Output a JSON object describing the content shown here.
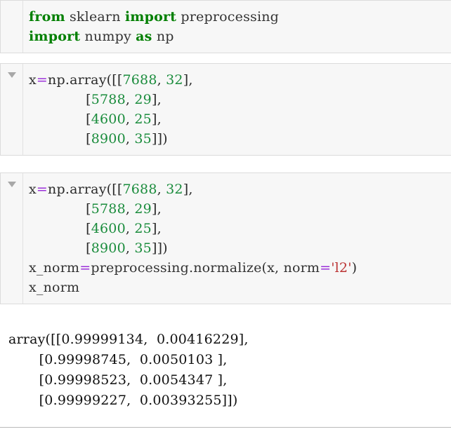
{
  "document": {
    "type": "jupyter-notebook",
    "colors": {
      "keyword": "#007f00",
      "number": "#1a8c3c",
      "operator": "#9b30d9",
      "string": "#bb3333",
      "text": "#2b2b2b",
      "cell_background": "#f7f7f7",
      "cell_border": "#dcdcdc",
      "output_text": "#101010",
      "triangle": "#a8a8a8"
    }
  },
  "cells": [
    {
      "id": "cell-imports",
      "has_collapse_triangle": false,
      "lines": [
        {
          "segments": [
            {
              "text": "from",
              "type": "kw"
            },
            {
              "text": " sklearn ",
              "type": "plain"
            },
            {
              "text": "import",
              "type": "kw"
            },
            {
              "text": " preprocessing",
              "type": "plain"
            }
          ]
        },
        {
          "segments": [
            {
              "text": "import",
              "type": "kw"
            },
            {
              "text": " numpy ",
              "type": "plain"
            },
            {
              "text": "as",
              "type": "kw"
            },
            {
              "text": " np",
              "type": "plain"
            }
          ]
        }
      ]
    },
    {
      "id": "cell-array",
      "has_collapse_triangle": true,
      "lines": [
        {
          "segments": [
            {
              "text": "x",
              "type": "plain"
            },
            {
              "text": "=",
              "type": "op"
            },
            {
              "text": "np.array([[",
              "type": "punc"
            },
            {
              "text": "7688",
              "type": "num"
            },
            {
              "text": ", ",
              "type": "punc"
            },
            {
              "text": "32",
              "type": "num"
            },
            {
              "text": "],",
              "type": "punc"
            }
          ]
        },
        {
          "segments": [
            {
              "text": "             [",
              "type": "punc"
            },
            {
              "text": "5788",
              "type": "num"
            },
            {
              "text": ", ",
              "type": "punc"
            },
            {
              "text": "29",
              "type": "num"
            },
            {
              "text": "],",
              "type": "punc"
            }
          ]
        },
        {
          "segments": [
            {
              "text": "             [",
              "type": "punc"
            },
            {
              "text": "4600",
              "type": "num"
            },
            {
              "text": ", ",
              "type": "punc"
            },
            {
              "text": "25",
              "type": "num"
            },
            {
              "text": "],",
              "type": "punc"
            }
          ]
        },
        {
          "segments": [
            {
              "text": "             [",
              "type": "punc"
            },
            {
              "text": "8900",
              "type": "num"
            },
            {
              "text": ", ",
              "type": "punc"
            },
            {
              "text": "35",
              "type": "num"
            },
            {
              "text": "]])",
              "type": "punc"
            }
          ]
        }
      ]
    },
    {
      "id": "cell-normalize",
      "has_collapse_triangle": true,
      "lines": [
        {
          "segments": [
            {
              "text": "x",
              "type": "plain"
            },
            {
              "text": "=",
              "type": "op"
            },
            {
              "text": "np.array([[",
              "type": "punc"
            },
            {
              "text": "7688",
              "type": "num"
            },
            {
              "text": ", ",
              "type": "punc"
            },
            {
              "text": "32",
              "type": "num"
            },
            {
              "text": "],",
              "type": "punc"
            }
          ]
        },
        {
          "segments": [
            {
              "text": "             [",
              "type": "punc"
            },
            {
              "text": "5788",
              "type": "num"
            },
            {
              "text": ", ",
              "type": "punc"
            },
            {
              "text": "29",
              "type": "num"
            },
            {
              "text": "],",
              "type": "punc"
            }
          ]
        },
        {
          "segments": [
            {
              "text": "             [",
              "type": "punc"
            },
            {
              "text": "4600",
              "type": "num"
            },
            {
              "text": ", ",
              "type": "punc"
            },
            {
              "text": "25",
              "type": "num"
            },
            {
              "text": "],",
              "type": "punc"
            }
          ]
        },
        {
          "segments": [
            {
              "text": "             [",
              "type": "punc"
            },
            {
              "text": "8900",
              "type": "num"
            },
            {
              "text": ", ",
              "type": "punc"
            },
            {
              "text": "35",
              "type": "num"
            },
            {
              "text": "]])",
              "type": "punc"
            }
          ]
        },
        {
          "segments": [
            {
              "text": "x_norm",
              "type": "plain"
            },
            {
              "text": "=",
              "type": "op"
            },
            {
              "text": "preprocessing.normalize(x, norm",
              "type": "plain"
            },
            {
              "text": "=",
              "type": "op"
            },
            {
              "text": "'l2'",
              "type": "str"
            },
            {
              "text": ")",
              "type": "punc"
            }
          ]
        },
        {
          "segments": [
            {
              "text": "x_norm",
              "type": "plain"
            }
          ]
        }
      ]
    }
  ],
  "output": {
    "id": "output-array",
    "lines": [
      "array([[0.99999134,  0.00416229],",
      "       [0.99998745,  0.0050103 ],",
      "       [0.99998523,  0.0054347 ],",
      "       [0.99999227,  0.00393255]])"
    ]
  }
}
